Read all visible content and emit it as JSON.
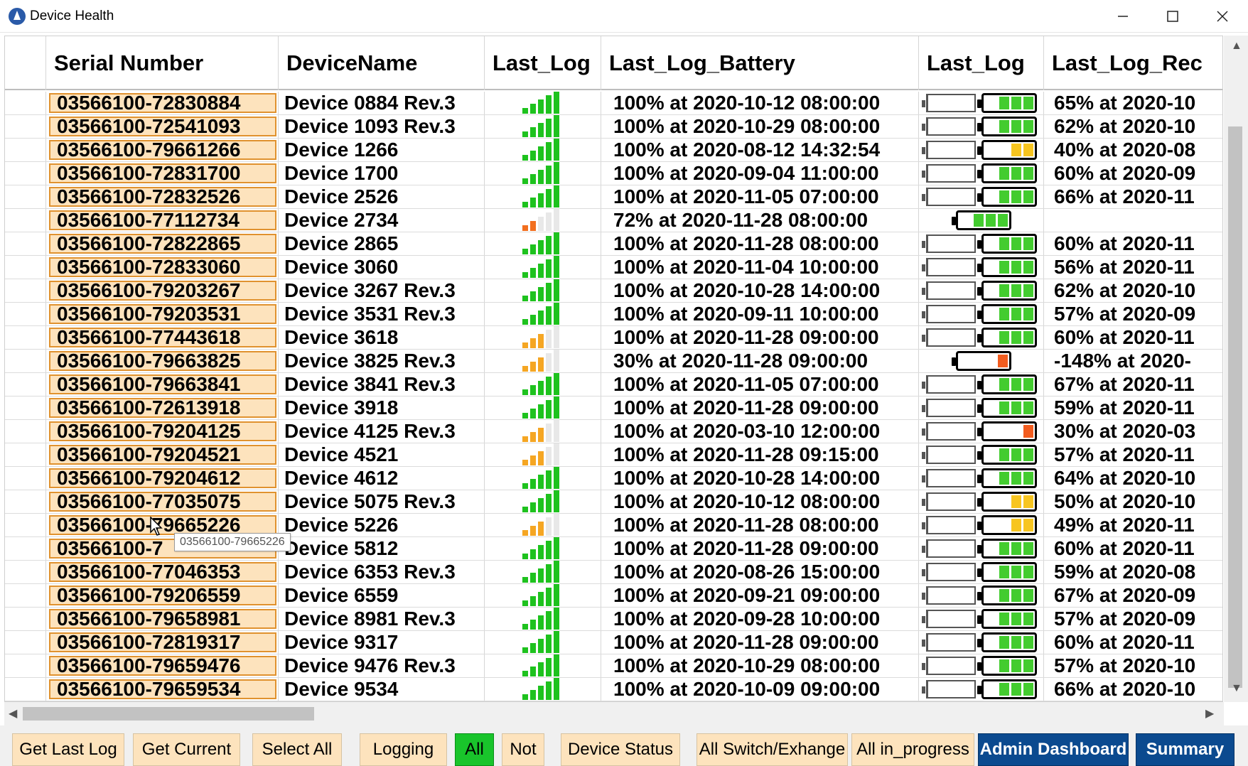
{
  "window": {
    "title": "Device Health"
  },
  "columns": [
    "",
    "Serial Number",
    "DeviceName",
    "Last_Log",
    "Last_Log_Battery",
    "Last_Log",
    "Last_Log_Rec"
  ],
  "colors": {
    "serial_bg": "#fde3bd",
    "serial_border": "#e0922f",
    "signal_green": "#1ec21e",
    "signal_orange": "#f5a623",
    "bat_green": "#43cc2f",
    "bat_yellow": "#f7c520",
    "bat_orange": "#f25c1f"
  },
  "rows": [
    {
      "serial": "03566100-72830884",
      "name": "Device 0884 Rev.3",
      "signal": "green",
      "battery": "100% at 2020-10-12 08:00:00",
      "bat": "green",
      "rec": "65% at 2020-10"
    },
    {
      "serial": "03566100-72541093",
      "name": "Device 1093 Rev.3",
      "signal": "green",
      "battery": "100% at 2020-10-29 08:00:00",
      "bat": "green",
      "rec": "62% at 2020-10"
    },
    {
      "serial": "03566100-79661266",
      "name": "Device 1266",
      "signal": "green",
      "battery": "100% at 2020-08-12 14:32:54",
      "bat": "yellow",
      "rec": "40% at 2020-08"
    },
    {
      "serial": "03566100-72831700",
      "name": "Device 1700",
      "signal": "green",
      "battery": "100% at 2020-09-04 11:00:00",
      "bat": "green",
      "rec": "60% at 2020-09"
    },
    {
      "serial": "03566100-72832526",
      "name": "Device 2526",
      "signal": "green",
      "battery": "100% at 2020-11-05 07:00:00",
      "bat": "green",
      "rec": "66% at 2020-11"
    },
    {
      "serial": "03566100-77112734",
      "name": "Device 2734",
      "signal": "orange-low",
      "battery": "72% at 2020-11-28 08:00:00",
      "bat": "green-only",
      "rec": ""
    },
    {
      "serial": "03566100-72822865",
      "name": "Device 2865",
      "signal": "green",
      "battery": "100% at 2020-11-28 08:00:00",
      "bat": "green",
      "rec": "60% at 2020-11"
    },
    {
      "serial": "03566100-72833060",
      "name": "Device 3060",
      "signal": "green",
      "battery": "100% at 2020-11-04 10:00:00",
      "bat": "green",
      "rec": "56% at 2020-11"
    },
    {
      "serial": "03566100-79203267",
      "name": "Device 3267 Rev.3",
      "signal": "green",
      "battery": "100% at 2020-10-28 14:00:00",
      "bat": "green",
      "rec": "62% at 2020-10"
    },
    {
      "serial": "03566100-79203531",
      "name": "Device 3531 Rev.3",
      "signal": "green",
      "battery": "100% at 2020-09-11 10:00:00",
      "bat": "green",
      "rec": "57% at 2020-09"
    },
    {
      "serial": "03566100-77443618",
      "name": "Device 3618",
      "signal": "orange",
      "battery": "100% at 2020-11-28 09:00:00",
      "bat": "green",
      "rec": "60% at 2020-11"
    },
    {
      "serial": "03566100-79663825",
      "name": "Device 3825 Rev.3",
      "signal": "orange",
      "battery": "30% at 2020-11-28 09:00:00",
      "bat": "orange-only",
      "rec": "-148% at 2020-"
    },
    {
      "serial": "03566100-79663841",
      "name": "Device 3841 Rev.3",
      "signal": "green",
      "battery": "100% at 2020-11-05 07:00:00",
      "bat": "green",
      "rec": "67% at 2020-11"
    },
    {
      "serial": "03566100-72613918",
      "name": "Device 3918",
      "signal": "green",
      "battery": "100% at 2020-11-28 09:00:00",
      "bat": "green",
      "rec": "59% at 2020-11"
    },
    {
      "serial": "03566100-79204125",
      "name": "Device 4125 Rev.3",
      "signal": "orange",
      "battery": "100% at 2020-03-10 12:00:00",
      "bat": "orange",
      "rec": "30% at 2020-03"
    },
    {
      "serial": "03566100-79204521",
      "name": "Device 4521",
      "signal": "orange",
      "battery": "100% at 2020-11-28 09:15:00",
      "bat": "green",
      "rec": "57% at 2020-11"
    },
    {
      "serial": "03566100-79204612",
      "name": "Device 4612",
      "signal": "green",
      "battery": "100% at 2020-10-28 14:00:00",
      "bat": "green",
      "rec": "64% at 2020-10"
    },
    {
      "serial": "03566100-77035075",
      "name": "Device 5075 Rev.3",
      "signal": "green",
      "battery": "100% at 2020-10-12 08:00:00",
      "bat": "yellow",
      "rec": "50% at 2020-10"
    },
    {
      "serial": "03566100-79665226",
      "name": "Device 5226",
      "signal": "orange",
      "battery": "100% at 2020-11-28 08:00:00",
      "bat": "yellow",
      "rec": "49% at 2020-11"
    },
    {
      "serial": "03566100-7",
      "name": "Device 5812",
      "signal": "green",
      "battery": "100% at 2020-11-28 09:00:00",
      "bat": "green",
      "rec": "60% at 2020-11"
    },
    {
      "serial": "03566100-77046353",
      "name": "Device 6353 Rev.3",
      "signal": "green",
      "battery": "100% at 2020-08-26 15:00:00",
      "bat": "green",
      "rec": "59% at 2020-08"
    },
    {
      "serial": "03566100-79206559",
      "name": "Device 6559",
      "signal": "green",
      "battery": "100% at 2020-09-21 09:00:00",
      "bat": "green",
      "rec": "67% at 2020-09"
    },
    {
      "serial": "03566100-79658981",
      "name": "Device 8981 Rev.3",
      "signal": "green",
      "battery": "100% at 2020-09-28 10:00:00",
      "bat": "green",
      "rec": "57% at 2020-09"
    },
    {
      "serial": "03566100-72819317",
      "name": "Device 9317",
      "signal": "green",
      "battery": "100% at 2020-11-28 09:00:00",
      "bat": "green",
      "rec": "60% at 2020-11"
    },
    {
      "serial": "03566100-79659476",
      "name": "Device 9476 Rev.3",
      "signal": "green",
      "battery": "100% at 2020-10-29 08:00:00",
      "bat": "green",
      "rec": "57% at 2020-10"
    },
    {
      "serial": "03566100-79659534",
      "name": "Device 9534",
      "signal": "green",
      "battery": "100% at 2020-10-09 09:00:00",
      "bat": "green",
      "rec": "66% at 2020-10"
    }
  ],
  "tooltip": "03566100-79665226",
  "buttons": {
    "get_last_log": "Get Last Log",
    "get_current": "Get Current",
    "select_all": "Select All",
    "logging": "Logging",
    "all": "All",
    "not": "Not",
    "device_status": "Device Status",
    "all_switch": "All Switch/Exhange",
    "all_in_progress": "All in_progress",
    "admin_dashboard": "Admin Dashboard",
    "summary": "Summary"
  }
}
